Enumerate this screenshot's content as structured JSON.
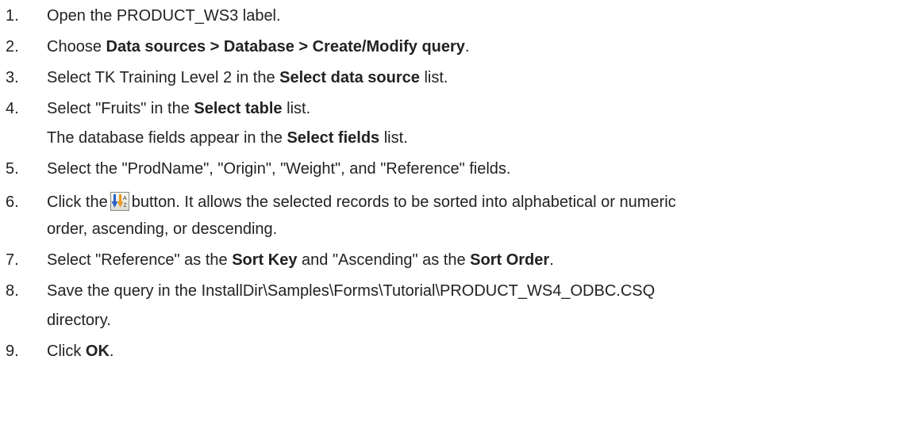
{
  "steps": [
    {
      "number": "1.",
      "pre": "Open the  PRODUCT_WS3 label."
    },
    {
      "number": "2.",
      "pre": "Choose ",
      "bold1": "Data sources > Database > Create/Modify query",
      "post1": "."
    },
    {
      "number": "3.",
      "pre": "Select TK Training Level 2 in the ",
      "bold1": "Select data source",
      "post1": " list."
    },
    {
      "number": "4.",
      "pre": "Select \"Fruits\" in the ",
      "bold1": "Select table",
      "post1": " list."
    },
    {
      "pre": "The database fields appear in the ",
      "bold1": "Select fields",
      "post1": " list."
    },
    {
      "number": "5.",
      "pre": "Select the \"ProdName\", \"Origin\", \"Weight\", and \"Reference\" fields."
    },
    {
      "number": "6.",
      "pre": "Click the",
      "icon": "sort-records-icon",
      "post": "button. It allows the selected records to be sorted into alphabetical or numeric"
    },
    {
      "pre": "order, ascending, or descending."
    },
    {
      "number": "7.",
      "pre": "Select \"Reference\" as the ",
      "bold1": "Sort Key",
      "post1": " and \"Ascending\" as the ",
      "bold2": "Sort Order",
      "post2": "."
    },
    {
      "number": "8.",
      "pre": "Save the query in the InstallDir\\Samples\\Forms\\Tutorial\\PRODUCT_WS4_ODBC.CSQ"
    },
    {
      "pre": "directory."
    },
    {
      "number": "9.",
      "pre": "Click ",
      "bold1": "OK",
      "post1": "."
    }
  ]
}
